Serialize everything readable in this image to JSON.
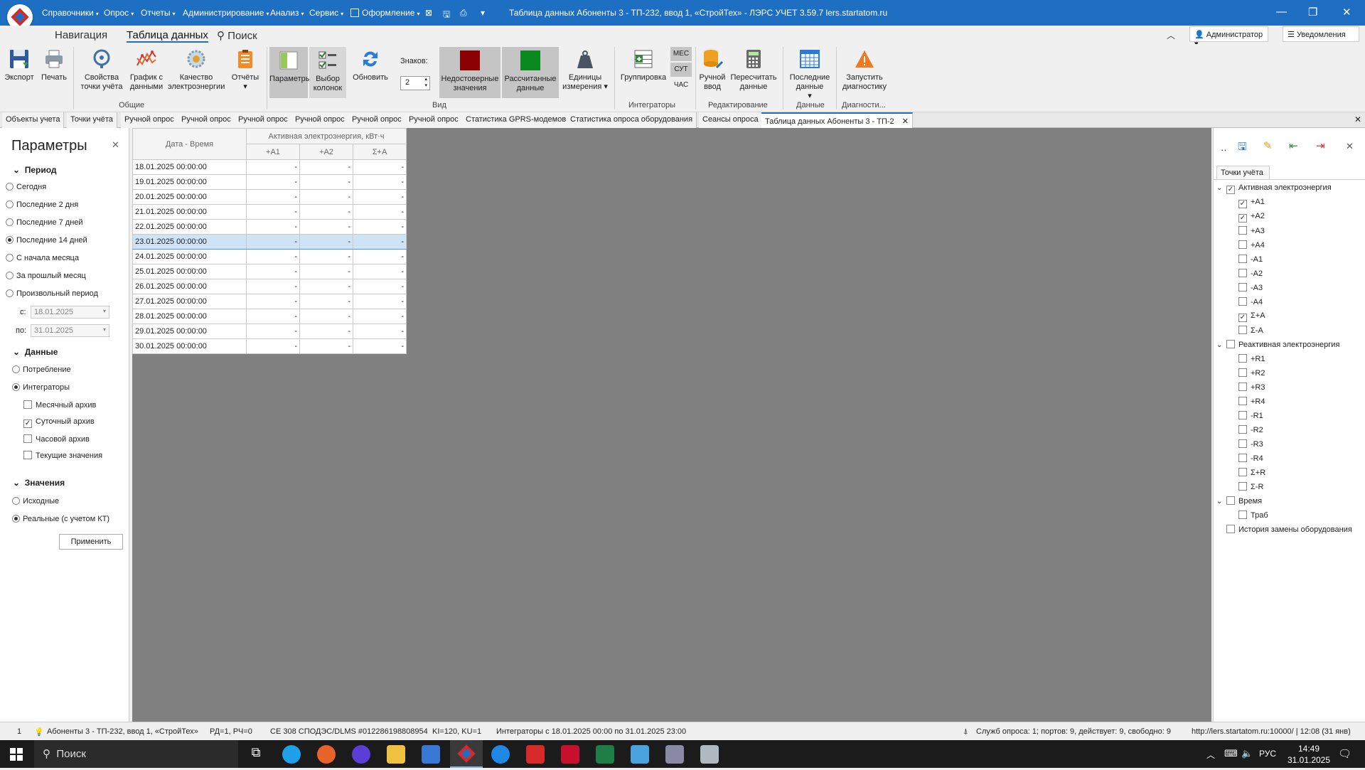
{
  "window": {
    "title": "Таблица данных Абоненты 3 - ТП-232, ввод 1, «СтройТех» - ЛЭРС УЧЕТ 3.59.7 lers.startatom.ru"
  },
  "menu": [
    "Справочники",
    "Опрос",
    "Отчеты",
    "Администрирование",
    "Анализ",
    "Сервис",
    "Оформление"
  ],
  "ribbon_tabs": [
    "Навигация",
    "Таблица данных",
    "Поиск"
  ],
  "user": {
    "name": "Администратор",
    "notifications": "Уведомления"
  },
  "ribbon": {
    "export": "Экспорт",
    "print": "Печать",
    "point_props": "Свойства точки учёта",
    "chart": "График с данными",
    "quality": "Качество электроэнергии",
    "reports": "Отчёты",
    "params": "Параметры",
    "columns": "Выбор колонок",
    "refresh": "Обновить",
    "digits_label": "Знаков:",
    "digits_value": "2",
    "unreliable": "Недостоверные значения",
    "calculated": "Рассчитанные данные",
    "units": "Единицы измерения",
    "grouping": "Группировка",
    "mes": "МЕС",
    "sut": "СУТ",
    "chas": "ЧАС",
    "manual": "Ручной ввод",
    "recalc": "Пересчитать данные",
    "last_data": "Последние данные",
    "diag": "Запустить диагностику",
    "groups": {
      "common": "Общие",
      "view": "Вид",
      "integrators": "Интеграторы",
      "edit": "Редактирование",
      "data": "Данные",
      "diag": "Диагности..."
    }
  },
  "doc_tabs": [
    "Объекты учета",
    "Точки учёта",
    "Ручной опрос",
    "Ручной опрос",
    "Ручной опрос",
    "Ручной опрос",
    "Ручной опрос",
    "Ручной опрос",
    "Статистика GPRS-модемов",
    "Статистика опроса оборудования",
    "Сеансы опроса",
    "Таблица данных Абоненты 3 - ТП-2"
  ],
  "params": {
    "title": "Параметры",
    "period_title": "Период",
    "period": [
      "Сегодня",
      "Последние 2 дня",
      "Последние 7 дней",
      "Последние 14 дней",
      "С начала месяца",
      "За прошлый месяц",
      "Произвольный период"
    ],
    "from_label": "с:",
    "from": "18.01.2025",
    "to_label": "по:",
    "to": "31.01.2025",
    "data_title": "Данные",
    "data_opts": [
      "Потребление",
      "Интеграторы"
    ],
    "archives": [
      "Месячный архив",
      "Суточный архив",
      "Часовой архив",
      "Текущие значения"
    ],
    "values_title": "Значения",
    "values_opts": [
      "Исходные",
      "Реальные (с учетом КТ)"
    ],
    "apply": "Применить"
  },
  "table": {
    "col_date": "Дата - Время",
    "group_header": "Активная электроэнергия, кВт·ч",
    "cols": [
      "+A1",
      "+A2",
      "Σ+A"
    ],
    "rows": [
      [
        "18.01.2025 00:00:00",
        "-",
        "-",
        "-"
      ],
      [
        "19.01.2025 00:00:00",
        "-",
        "-",
        "-"
      ],
      [
        "20.01.2025 00:00:00",
        "-",
        "-",
        "-"
      ],
      [
        "21.01.2025 00:00:00",
        "-",
        "-",
        "-"
      ],
      [
        "22.01.2025 00:00:00",
        "-",
        "-",
        "-"
      ],
      [
        "23.01.2025 00:00:00",
        "-",
        "-",
        "-"
      ],
      [
        "24.01.2025 00:00:00",
        "-",
        "-",
        "-"
      ],
      [
        "25.01.2025 00:00:00",
        "-",
        "-",
        "-"
      ],
      [
        "26.01.2025 00:00:00",
        "-",
        "-",
        "-"
      ],
      [
        "27.01.2025 00:00:00",
        "-",
        "-",
        "-"
      ],
      [
        "28.01.2025 00:00:00",
        "-",
        "-",
        "-"
      ],
      [
        "29.01.2025 00:00:00",
        "-",
        "-",
        "-"
      ],
      [
        "30.01.2025 00:00:00",
        "-",
        "-",
        "-"
      ]
    ]
  },
  "right": {
    "tab": "Точки учёта",
    "active": "Активная электроэнергия",
    "active_items": [
      "+A1",
      "+A2",
      "+A3",
      "+A4",
      "-A1",
      "-A2",
      "-A3",
      "-A4",
      "Σ+A",
      "Σ-A"
    ],
    "reactive": "Реактивная электроэнергия",
    "reactive_items": [
      "+R1",
      "+R2",
      "+R3",
      "+R4",
      "-R1",
      "-R2",
      "-R3",
      "-R4",
      "Σ+R",
      "Σ-R"
    ],
    "time": "Время",
    "time_items": [
      "Траб"
    ],
    "history": "История замены оборудования"
  },
  "status": {
    "n": "1",
    "object": "Абоненты 3 - ТП-232, ввод 1, «СтройТех»",
    "rd": "РД=1, РЧ=0",
    "device": "CE 308 СПОДЭС/DLMS #012286198808954",
    "ki": "KI=120, KU=1",
    "integrators": "Интеграторы с 18.01.2025 00:00 по 31.01.2025 23:00",
    "services": "Служб опроса: 1; портов: 9, действует: 9, свободно: 9",
    "url": "http://lers.startatom.ru:10000/ | 12:08 (31 янв)"
  },
  "taskbar": {
    "search": "Поиск",
    "lang": "РУС",
    "time": "14:49",
    "date": "31.01.2025"
  }
}
